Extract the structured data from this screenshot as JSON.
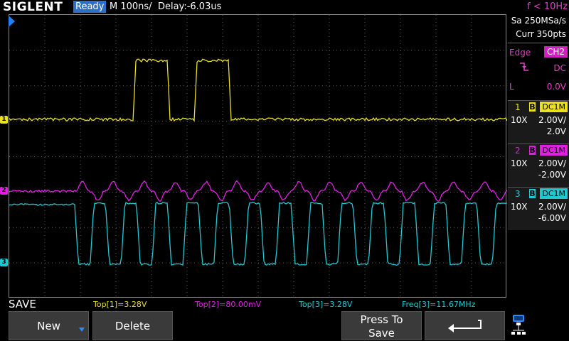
{
  "brand": "SIGLENT",
  "status": "Ready",
  "timebase": "M 100ns/",
  "delay": "Delay:-6.03us",
  "trigger_freq": "f < 10Hz",
  "acquisition": {
    "sample_rate": "Sa 250MSa/s",
    "memory": "Curr 350pts"
  },
  "trigger": {
    "type": "Edge",
    "source": "CH2",
    "coupling": "DC",
    "mode_label": "L",
    "level": "0.0V"
  },
  "channels": [
    {
      "num": "1",
      "bw": "B",
      "coupling": "DC1M",
      "probe": "10X",
      "scale": "2.00V/",
      "offset": "2.0V",
      "color": "#e8e020"
    },
    {
      "num": "2",
      "bw": "B",
      "coupling": "DC1M",
      "probe": "10X",
      "scale": "2.00V/",
      "offset": "-2.00V",
      "color": "#e020e0"
    },
    {
      "num": "3",
      "bw": "B",
      "coupling": "DC1M",
      "probe": "10X",
      "scale": "2.00V/",
      "offset": "-6.00V",
      "color": "#20c8d0"
    }
  ],
  "channel_markers": [
    "1",
    "2",
    "3"
  ],
  "menu_title": "SAVE",
  "measurements": [
    {
      "text": "Top[1]=3.28V",
      "color": "#e8e020"
    },
    {
      "text": "Top[2]=80.00mV",
      "color": "#e020e0"
    },
    {
      "text": "Top[3]=3.28V",
      "color": "#20c8d0"
    },
    {
      "text": "Freq[3]=11.67MHz",
      "color": "#20c8d0"
    }
  ],
  "softkeys": {
    "new": "New",
    "delete": "Delete",
    "press_to_save_1": "Press To",
    "press_to_save_2": "Save",
    "back_icon": "return-arrow-icon"
  },
  "icons": {
    "lan": "lan-connected-icon",
    "trigger_edge": "falling-edge-icon",
    "dropdown": "blue-down-arrow-icon"
  }
}
